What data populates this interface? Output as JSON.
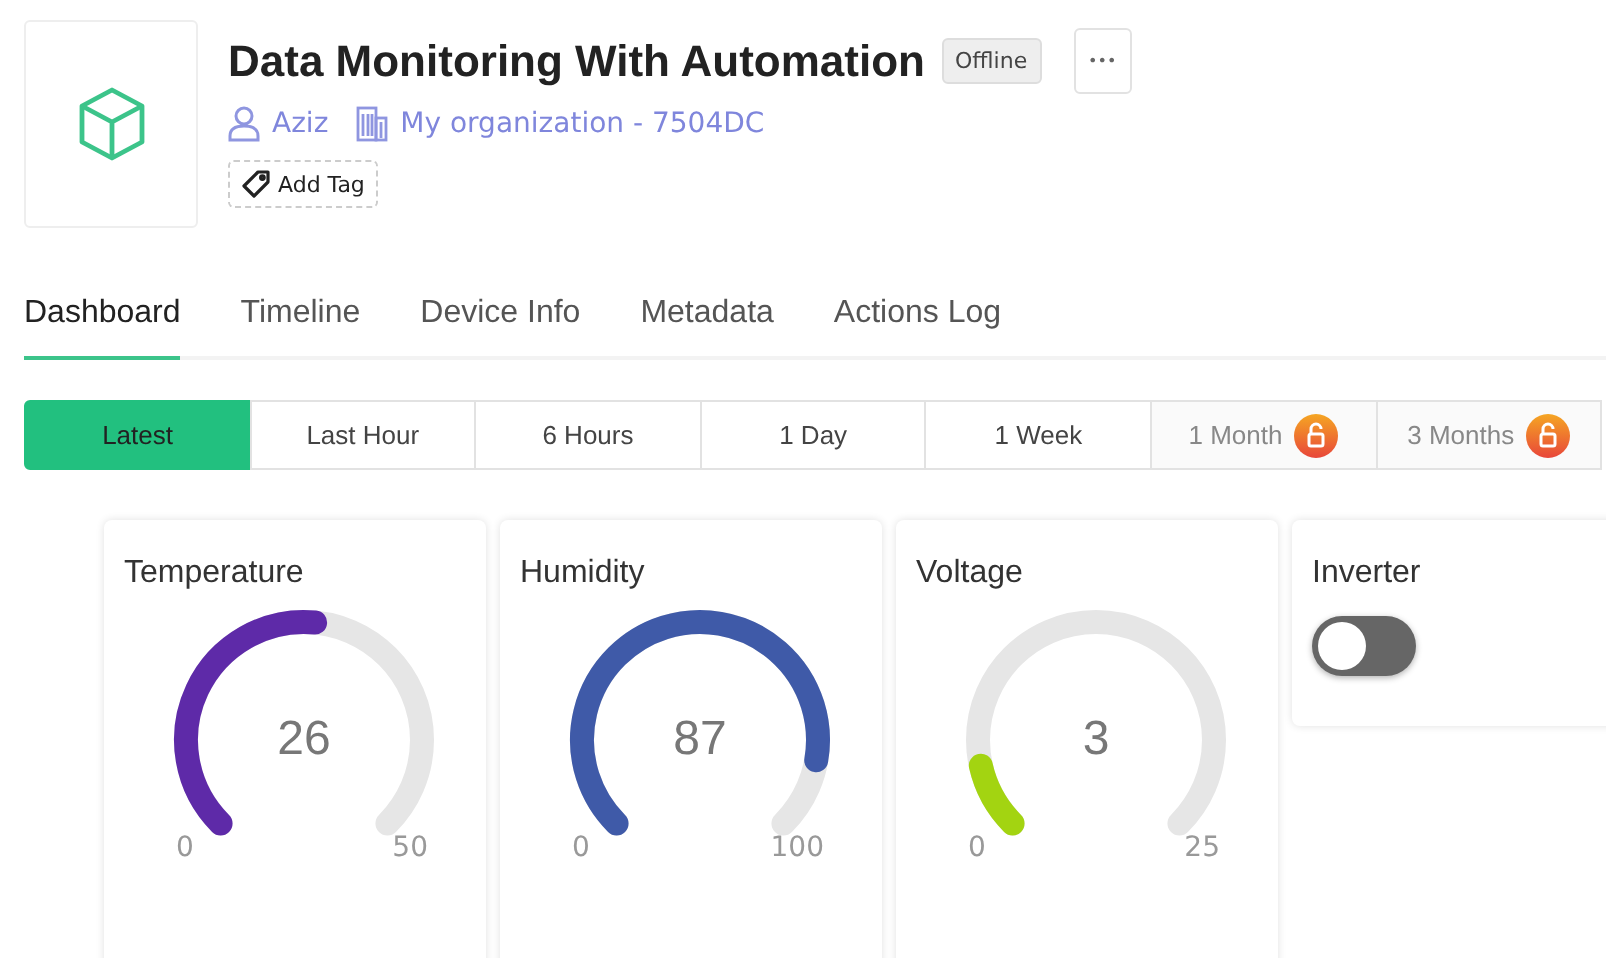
{
  "device": {
    "title": "Data Monitoring With Automation",
    "status": "Offline",
    "owner": "Aziz",
    "organization": "My organization - 7504DC",
    "add_tag": "Add Tag",
    "menu": "•••"
  },
  "tabs": [
    {
      "label": "Dashboard",
      "selected": true
    },
    {
      "label": "Timeline",
      "selected": false
    },
    {
      "label": "Device Info",
      "selected": false
    },
    {
      "label": "Metadata",
      "selected": false
    },
    {
      "label": "Actions Log",
      "selected": false
    }
  ],
  "ranges": [
    {
      "label": "Latest",
      "selected": true,
      "locked": false
    },
    {
      "label": "Last Hour",
      "selected": false,
      "locked": false
    },
    {
      "label": "6 Hours",
      "selected": false,
      "locked": false
    },
    {
      "label": "1 Day",
      "selected": false,
      "locked": false
    },
    {
      "label": "1 Week",
      "selected": false,
      "locked": false
    },
    {
      "label": "1 Month",
      "selected": false,
      "locked": true
    },
    {
      "label": "3 Months",
      "selected": false,
      "locked": true
    }
  ],
  "cards": [
    {
      "kind": "gauge",
      "title": "Temperature",
      "value": "26",
      "min": "0",
      "max": "50",
      "color": "#5e2aa8"
    },
    {
      "kind": "gauge",
      "title": "Humidity",
      "value": "87",
      "min": "0",
      "max": "100",
      "color": "#3f5aa8"
    },
    {
      "kind": "gauge",
      "title": "Voltage",
      "value": "3",
      "min": "0",
      "max": "25",
      "color": "#a3d411"
    },
    {
      "kind": "switch",
      "title": "Inverter",
      "on": false
    }
  ]
}
